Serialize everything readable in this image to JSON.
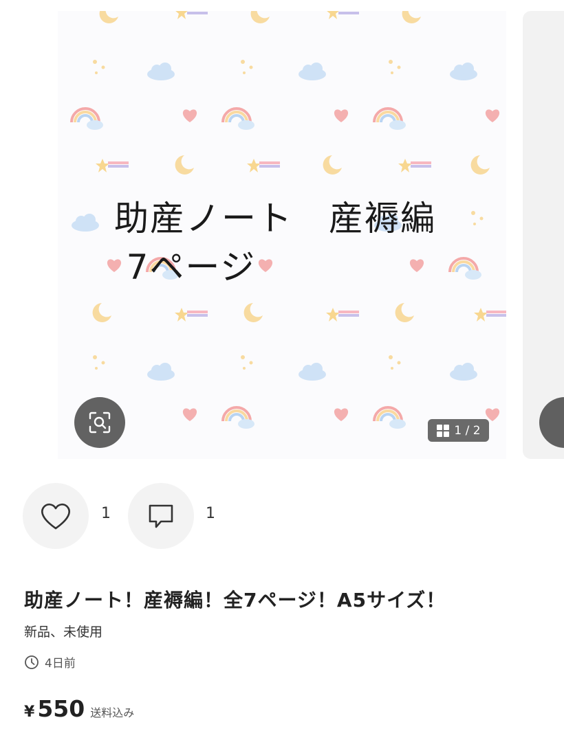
{
  "image": {
    "overlay_line1": "助産ノート　産褥編",
    "overlay_line2": "7ページ",
    "page_indicator": "1 / 2",
    "zoom_icon": "zoom-scan-icon",
    "grid_icon": "grid-icon"
  },
  "actions": {
    "like_icon": "heart-icon",
    "like_count": "1",
    "comment_icon": "comment-icon",
    "comment_count": "1"
  },
  "item": {
    "title": "助産ノート！産褥編！全7ページ！A5サイズ！",
    "condition": "新品、未使用",
    "posted_icon": "clock-icon",
    "posted": "4日前",
    "currency": "¥",
    "price": "550",
    "shipping": "送料込み"
  }
}
